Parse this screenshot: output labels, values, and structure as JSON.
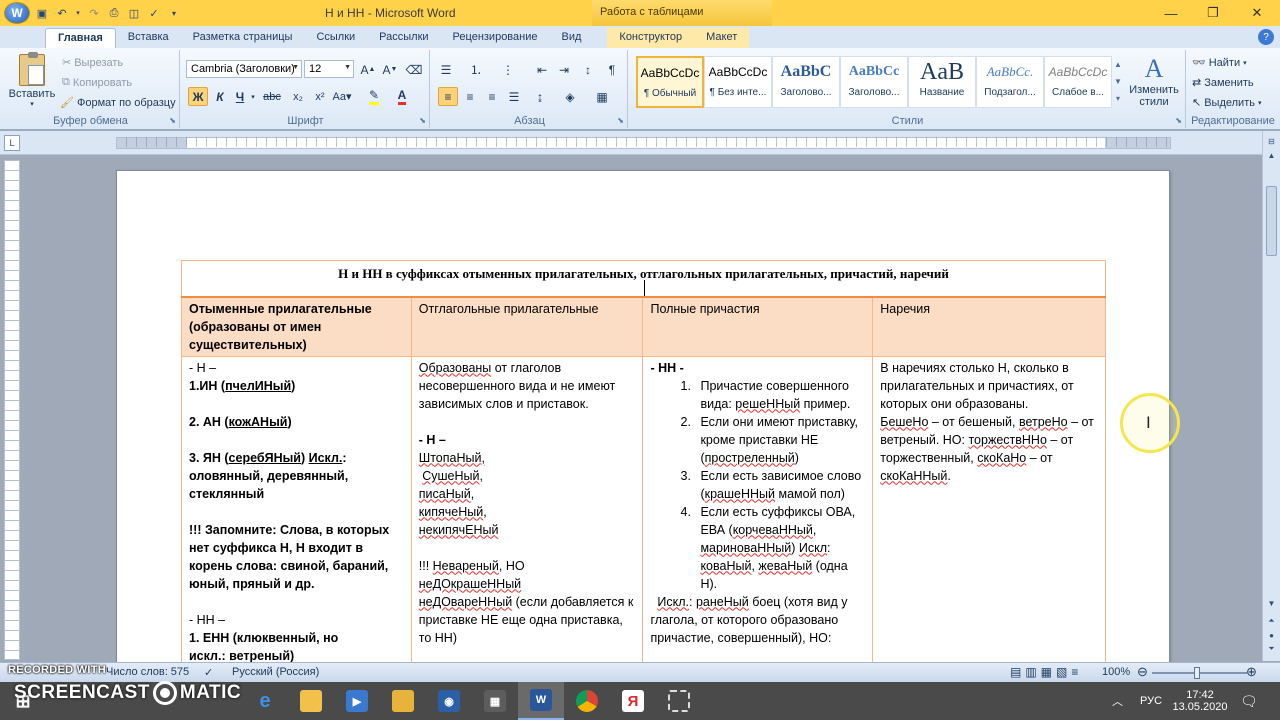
{
  "window": {
    "title": "Н и НН - Microsoft Word",
    "context_title": "Работа с таблицами"
  },
  "tabs": [
    {
      "label": "Главная"
    },
    {
      "label": "Вставка"
    },
    {
      "label": "Разметка страницы"
    },
    {
      "label": "Ссылки"
    },
    {
      "label": "Рассылки"
    },
    {
      "label": "Рецензирование"
    },
    {
      "label": "Вид"
    },
    {
      "label": "Конструктор"
    },
    {
      "label": "Макет"
    }
  ],
  "ribbon": {
    "clipboard": {
      "label": "Буфер обмена",
      "paste": "Вставить",
      "cut": "Вырезать",
      "copy": "Копировать",
      "format_painter": "Формат по образцу"
    },
    "font": {
      "label": "Шрифт",
      "font_name": "Cambria (Заголовки)",
      "font_size": "12",
      "bold": "Ж",
      "italic": "К",
      "underline": "Ч"
    },
    "paragraph": {
      "label": "Абзац"
    },
    "styles": {
      "label": "Стили",
      "items": [
        {
          "preview": "AaBbCcDc",
          "name": "¶ Обычный"
        },
        {
          "preview": "AaBbCcDc",
          "name": "¶ Без инте..."
        },
        {
          "preview": "AaBbC",
          "name": "Заголово..."
        },
        {
          "preview": "AaBbCc",
          "name": "Заголово..."
        },
        {
          "preview": "AaB",
          "name": "Название"
        },
        {
          "preview": "AaBbCc.",
          "name": "Подзагол..."
        },
        {
          "preview": "AaBbCcDc",
          "name": "Слабое в..."
        }
      ],
      "change_styles": "Изменить стили"
    },
    "editing": {
      "label": "Редактирование",
      "find": "Найти",
      "replace": "Заменить",
      "select": "Выделить"
    }
  },
  "document": {
    "title_row": "Н и НН в суффиксах отыменных прилагательных, отглагольных прилагательных, причастий, наречий",
    "headers": [
      "Отыменные прилагательные (образованы от имен существительных)",
      "Отглагольные прилагательные",
      "Полные причастия",
      "Наречия"
    ],
    "col1": {
      "l1": "- Н –",
      "l2a": "1.ИН (",
      "l2b": "пчелИНый",
      "l2c": ")",
      "l3a": "2. АН (",
      "l3b": "кожАНый",
      "l3c": ")",
      "l4a": "3. ЯН (",
      "l4b": "серебЯНый",
      "l4c": ") ",
      "l4d": "Искл.",
      "l4e": ": оловянный, деревянный, стеклянный",
      "l5": "!!! Запомните: Слова, в которых нет суффикса Н, Н входит в корень слова: свиной, бараний, юный, пряный и др.",
      "l6": "- НН –",
      "l7": "1. ЕНН (клюквенный, но",
      "l8": "искл.: ветреный)"
    },
    "col2": {
      "l1a": "Образованы",
      "l1b": " от глаголов несовершенного вида и не имеют зависимых слов и приставок.",
      "l2": "- Н –",
      "w1": "ШтопаНый",
      "w2": "СушеНый",
      "w3": "писаНый",
      "w4": "кипячеНый",
      "w5": "некипячЕНый",
      "n1a": "!!!  ",
      "n1b": "Невареный",
      "n1c": ", НО",
      "n2": "неДОкрашеННый",
      "n3a": "неДОвареННый",
      "n3b": " (если добавляется к приставке НЕ еще одна приставка, то НН)"
    },
    "col3": {
      "head": "- НН -",
      "items": [
        {
          "a": "Причастие совершенного вида: ",
          "b": "решеННый",
          "c": " пример."
        },
        {
          "a": "Если они имеют приставку, кроме приставки НЕ (",
          "b": "простреленный",
          "c": ")"
        },
        {
          "a": "Если есть зависимое слово (",
          "b": "крашеННый",
          "c": " мамой пол)"
        },
        {
          "a": "Если есть суффиксы ОВА, ЕВА (",
          "b": "корчеваННый",
          "c": ", ",
          "d": "мариноваННый",
          "e": ") ",
          "f": "Искл",
          "g": ": ",
          "h": "коваНый",
          "i": ", ",
          "j": "жеваНый",
          "k": " (одна Н)."
        }
      ],
      "tail_a": "Искл.",
      "tail_b": ": ",
      "tail_c": "ранеНый",
      "tail_d": " боец (хотя вид у глагола, от которого  образовано причастие, совершенный), НО:"
    },
    "col4": {
      "l1": "В наречиях столько Н, сколько  в прилагательных и причастиях, от которых они образованы.",
      "a": "БешеНо",
      "b": " – от бешеный,  ",
      "c": "ветреНо",
      "d": " – от ветреный. НО: ",
      "e": "торжествННо",
      "f": " – от торжественный, ",
      "g": "скоКаНо",
      "h": " – от ",
      "i": "скоКаННый",
      "j": "."
    }
  },
  "statusbar": {
    "words": "Число слов: 575",
    "language": "Русский (Россия)",
    "zoom": "100%"
  },
  "taskbar": {
    "lang": "РУС",
    "time": "17:42",
    "date": "13.05.2020"
  },
  "watermark": {
    "recorded": "RECORDED WITH",
    "brand_a": "SCREENCAST",
    "brand_b": "MATIC"
  }
}
